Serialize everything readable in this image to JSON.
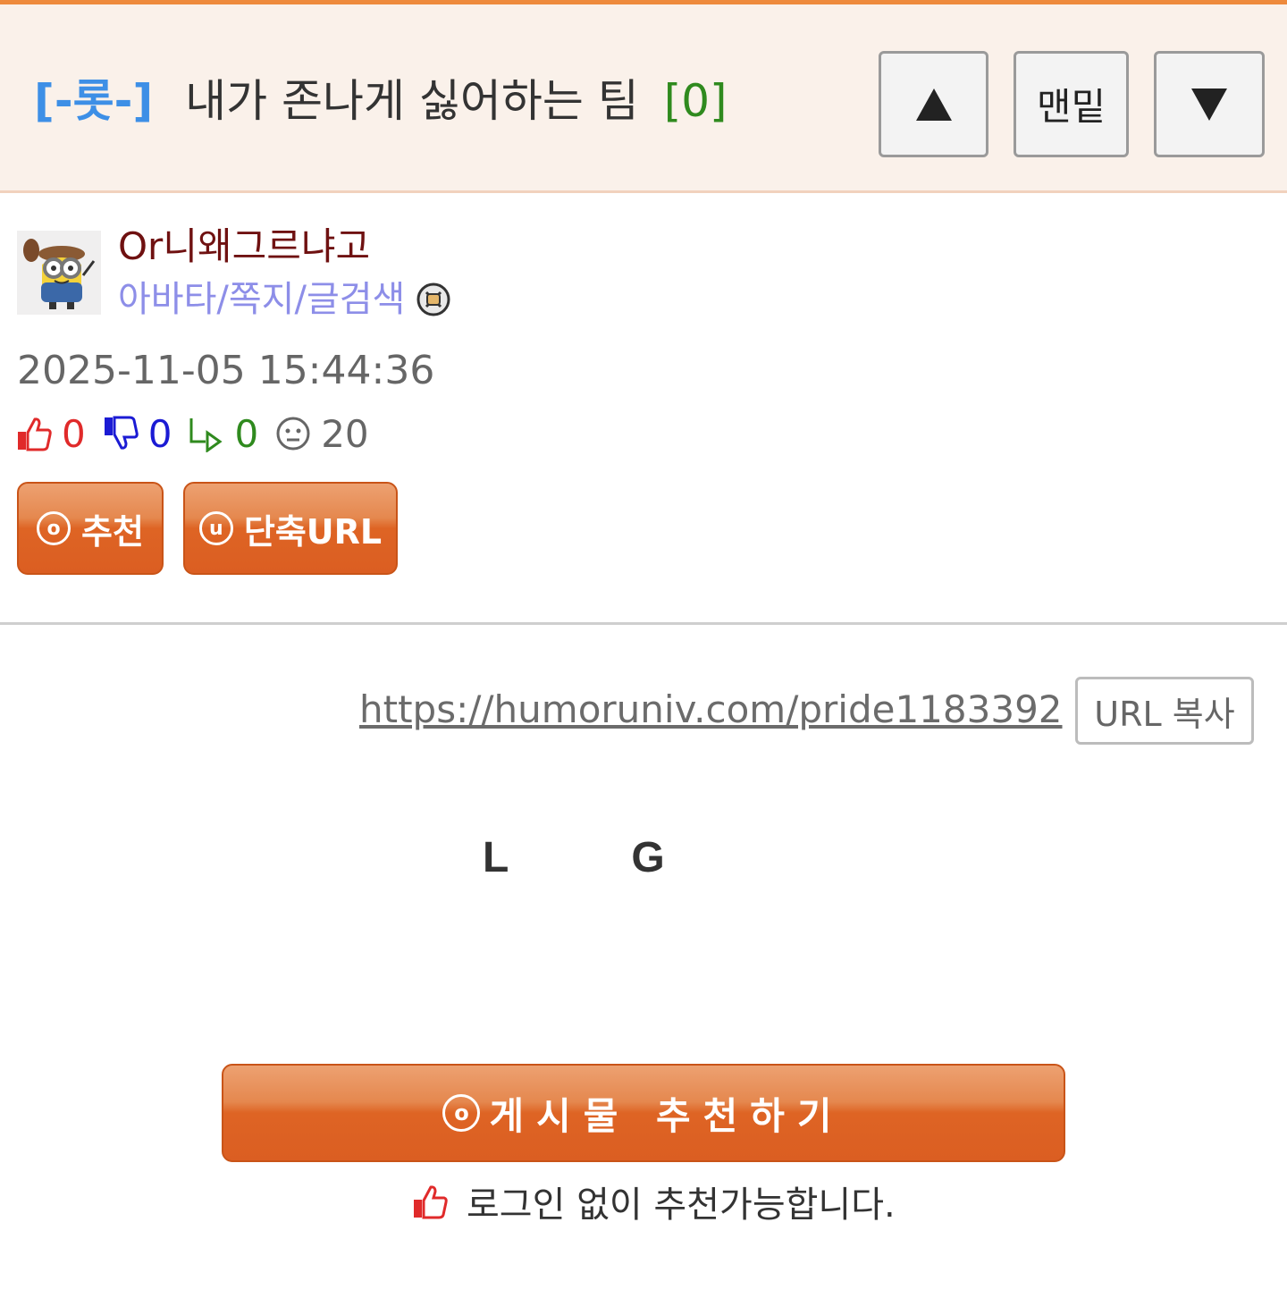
{
  "header": {
    "category": "[-롯-]",
    "title": "내가 존나게 싫어하는 팀",
    "comment_count": "[0]",
    "nav": {
      "up": "▲",
      "bottom": "맨밑",
      "down": "▼"
    }
  },
  "author": {
    "name": "Or니왜그르냐고",
    "links": "아바타/쪽지/글검색"
  },
  "post": {
    "date": "2025-11-05 15:44:36",
    "stats": {
      "up": "0",
      "down": "0",
      "reply": "0",
      "views": "20"
    },
    "buttons": {
      "recommend": "추천",
      "recommend_badge": "o",
      "short_url": "단축URL",
      "short_url_badge": "u"
    },
    "url": "https://humoruniv.com/pride1183392",
    "copy_url": "URL 복사",
    "logo_fragment": {
      "left": "L",
      "right": "G"
    }
  },
  "footer": {
    "recommend_button": "게시물 추천하기",
    "recommend_badge": "o",
    "note": "로그인 없이 추천가능합니다."
  },
  "colors": {
    "accent_orange": "#de6424",
    "category_blue": "#3d8fe6",
    "count_green": "#2f8a1e",
    "author_red": "#6f1111",
    "link_purple": "#8d8ee8"
  },
  "icons": [
    "thumbs-up-icon",
    "thumbs-down-icon",
    "reply-icon",
    "view-face-icon",
    "no-avatar-badge-icon"
  ]
}
